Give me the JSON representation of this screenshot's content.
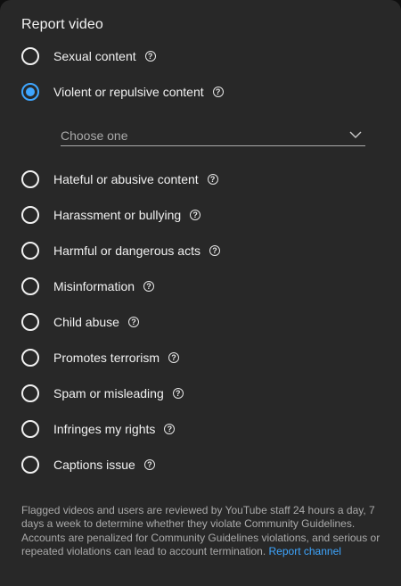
{
  "dialog": {
    "title": "Report video",
    "options": [
      {
        "label": "Sexual content",
        "checked": false
      },
      {
        "label": "Violent or repulsive content",
        "checked": true
      },
      {
        "label": "Hateful or abusive content",
        "checked": false
      },
      {
        "label": "Harassment or bullying",
        "checked": false
      },
      {
        "label": "Harmful or dangerous acts",
        "checked": false
      },
      {
        "label": "Misinformation",
        "checked": false
      },
      {
        "label": "Child abuse",
        "checked": false
      },
      {
        "label": "Promotes terrorism",
        "checked": false
      },
      {
        "label": "Spam or misleading",
        "checked": false
      },
      {
        "label": "Infringes my rights",
        "checked": false
      },
      {
        "label": "Captions issue",
        "checked": false
      }
    ],
    "subreason_select": {
      "value": "Choose one"
    },
    "help_icon_glyph": "?",
    "footer": {
      "text": "Flagged videos and users are reviewed by YouTube staff 24 hours a day, 7 days a week to determine whether they violate Community Guidelines. Accounts are penalized for Community Guidelines violations, and serious or repeated violations can lead to account termination.",
      "link_label": "Report channel"
    }
  },
  "colors": {
    "dialog_background": "#282828",
    "accent": "#3ea6ff",
    "text_primary": "#f1f1f1",
    "text_secondary": "#aaaaaa"
  },
  "icons": {
    "radio": "radio-icon",
    "help": "help-circle-icon",
    "dropdown": "chevron-down-icon"
  }
}
